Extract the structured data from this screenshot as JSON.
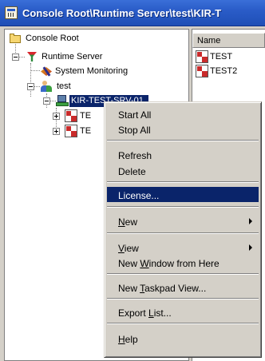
{
  "window": {
    "title": "Console Root\\Runtime Server\\test\\KIR-T"
  },
  "tree": {
    "root_label": "Console Root",
    "runtime_label": "Runtime Server",
    "monitoring_label": "System Monitoring",
    "group_label": "test",
    "selected_label": "KIR-TEST-SRV-01",
    "child1_label": "TE",
    "child2_label": "TE"
  },
  "list": {
    "column_name": "Name",
    "items": [
      "TEST",
      "TEST2"
    ]
  },
  "context_menu": {
    "start_all": "Start All",
    "stop_all": "Stop All",
    "refresh": "Refresh",
    "delete": "Delete",
    "license": "License...",
    "new": {
      "accel": "N",
      "rest": "ew"
    },
    "view": {
      "accel": "V",
      "rest": "iew"
    },
    "new_window": {
      "pre": "New ",
      "accel": "W",
      "rest": "indow from Here"
    },
    "new_taskpad": {
      "pre": "New ",
      "accel": "T",
      "rest": "askpad View..."
    },
    "export_list": {
      "pre": "Export ",
      "accel": "L",
      "rest": "ist..."
    },
    "help": {
      "accel": "H",
      "rest": "elp"
    }
  },
  "colors": {
    "title_bar": "#2a5cc8",
    "selection": "#0a246a",
    "menu_background": "#d4d0c8"
  }
}
